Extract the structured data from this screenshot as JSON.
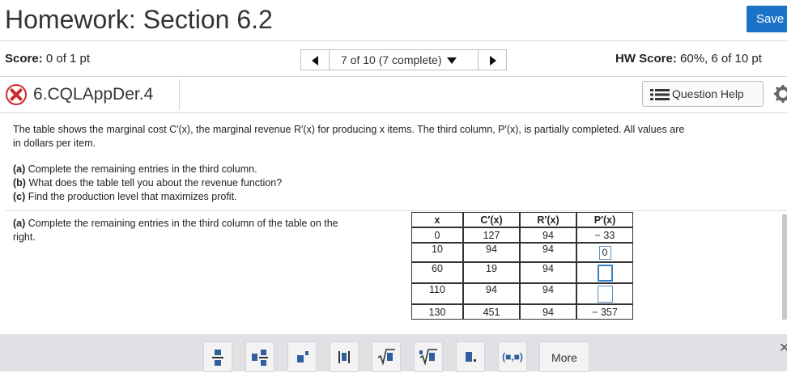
{
  "header": {
    "title": "Homework: Section 6.2",
    "save_label": "Save"
  },
  "scorebar": {
    "score_label": "Score:",
    "score_value": "0 of 1 pt",
    "nav_text": "7 of 10 (7 complete)",
    "hw_label": "HW Score:",
    "hw_value": "60%, 6 of 10 pt"
  },
  "question": {
    "id": "6.CQLAppDer.4",
    "help_label": "Question Help",
    "status_icon": "x-incorrect-icon"
  },
  "problem": {
    "intro_line1": "The table shows the marginal cost C′(x), the marginal revenue R′(x) for producing x items. The third column, P′(x), is partially completed. All values are",
    "intro_line2": "in dollars per item.",
    "a_tag": "(a)",
    "a_text": "Complete the remaining entries in the third column.",
    "b_tag": "(b)",
    "b_text": "What does the table tell you about the revenue function?",
    "c_tag": "(c)",
    "c_text": "Find the production level that maximizes profit.",
    "part_a_tag": "(a)",
    "part_a_line1": "Complete the remaining entries in the third column of the table on the",
    "part_a_line2": "right."
  },
  "table": {
    "headers": [
      "x",
      "C′(x)",
      "R′(x)",
      "P′(x)"
    ],
    "rows": [
      {
        "x": "0",
        "c": "127",
        "r": "94",
        "p": "− 33"
      },
      {
        "x": "10",
        "c": "94",
        "r": "94",
        "p": "0"
      },
      {
        "x": "60",
        "c": "19",
        "r": "94",
        "p": ""
      },
      {
        "x": "110",
        "c": "94",
        "r": "94",
        "p": ""
      },
      {
        "x": "130",
        "c": "451",
        "r": "94",
        "p": "− 357"
      }
    ]
  },
  "toolbar": {
    "buttons": [
      "fraction-icon",
      "mixed-number-icon",
      "exponent-icon",
      "absolute-value-icon",
      "sqrt-icon",
      "nth-root-icon",
      "decimal-icon",
      "interval-icon"
    ],
    "interval_label": "(■,■)",
    "more_label": "More"
  }
}
